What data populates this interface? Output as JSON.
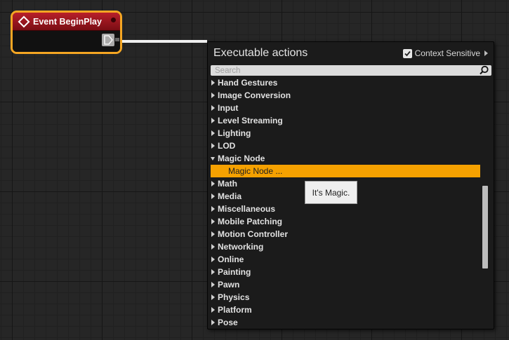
{
  "node": {
    "title": "Event BeginPlay",
    "header_color": "#a0141e",
    "border_color": "#f5a623"
  },
  "menu": {
    "title": "Executable actions",
    "context_sensitive_label": "Context Sensitive",
    "context_sensitive_checked": true,
    "search_placeholder": "Search",
    "search_value": "",
    "items": [
      {
        "label": "Hand Gestures",
        "expanded": false
      },
      {
        "label": "Image Conversion",
        "expanded": false
      },
      {
        "label": "Input",
        "expanded": false
      },
      {
        "label": "Level Streaming",
        "expanded": false
      },
      {
        "label": "Lighting",
        "expanded": false
      },
      {
        "label": "LOD",
        "expanded": false
      },
      {
        "label": "Magic Node",
        "expanded": true
      },
      {
        "label": "Magic Node ...",
        "selected": true,
        "child": true
      },
      {
        "label": "Math",
        "expanded": false
      },
      {
        "label": "Media",
        "expanded": false
      },
      {
        "label": "Miscellaneous",
        "expanded": false
      },
      {
        "label": "Mobile Patching",
        "expanded": false
      },
      {
        "label": "Motion Controller",
        "expanded": false
      },
      {
        "label": "Networking",
        "expanded": false
      },
      {
        "label": "Online",
        "expanded": false
      },
      {
        "label": "Painting",
        "expanded": false
      },
      {
        "label": "Pawn",
        "expanded": false
      },
      {
        "label": "Physics",
        "expanded": false
      },
      {
        "label": "Platform",
        "expanded": false
      },
      {
        "label": "Pose",
        "expanded": false
      }
    ],
    "selection_color": "#f5a100"
  },
  "tooltip": {
    "text": "It's Magic."
  }
}
